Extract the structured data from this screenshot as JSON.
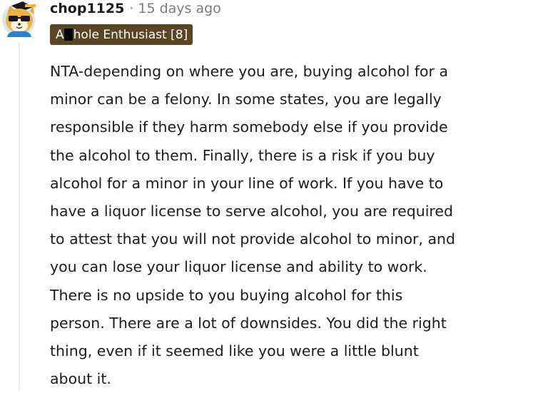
{
  "comment": {
    "username": "chop1125",
    "separator": "·",
    "timestamp": "15 days ago",
    "flair": {
      "prefix": "A",
      "redacted": true,
      "suffix": "hole Enthusiast [8]",
      "background_color": "#5a4524"
    },
    "avatar_icon": "snoo-avatar-icon",
    "body_lines": [
      "NTA-depending on where you are, buying alcohol for a",
      "minor can be a felony. In some states, you are legally",
      "responsible if they harm somebody else if you provide",
      "the alcohol to them. Finally, there is a risk if you buy",
      "alcohol for a minor in your line of work. If you have to",
      "have a liquor license to serve alcohol, you are required",
      "to attest that you will not provide alcohol to minor, and",
      "you can lose your liquor license and ability to work.",
      "There is no upside to you buying alcohol for this",
      "person. There are a lot of downsides. You did the right",
      "thing, even if it seemed like you were a little blunt",
      "about it."
    ]
  }
}
